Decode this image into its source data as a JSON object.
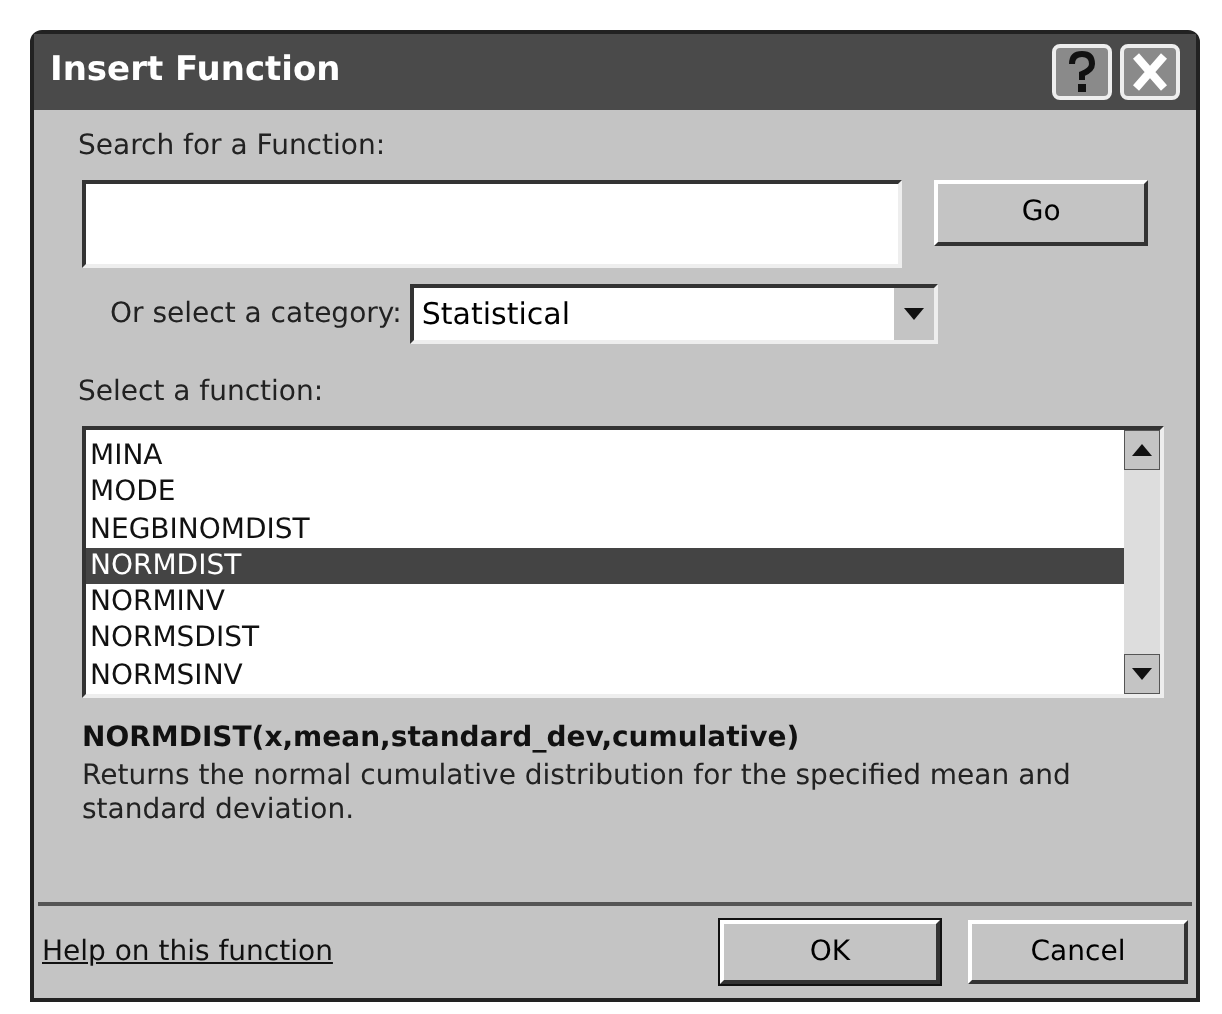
{
  "window": {
    "title": "Insert Function"
  },
  "search": {
    "label": "Search for a Function:",
    "go_button": "Go"
  },
  "category": {
    "label": "Or select a category:",
    "value": "Statistical"
  },
  "function_list": {
    "label": "Select a function:",
    "items": [
      {
        "name": "MINA",
        "selected": false
      },
      {
        "name": "MODE",
        "selected": false
      },
      {
        "name": "NEGBINOMDIST",
        "selected": false
      },
      {
        "name": "NORMDIST",
        "selected": true
      },
      {
        "name": "NORMINV",
        "selected": false
      },
      {
        "name": "NORMSDIST",
        "selected": false
      },
      {
        "name": "NORMSINV",
        "selected": false
      }
    ]
  },
  "signature": "NORMDIST(x,mean,standard_dev,cumulative)",
  "description": "Returns the normal cumulative distribution for the specified mean and standard deviation.",
  "help_link": "Help on this function",
  "buttons": [
    "OK",
    "Cancel"
  ]
}
